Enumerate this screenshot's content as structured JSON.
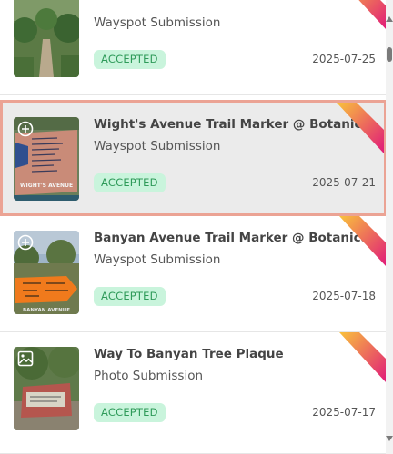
{
  "colors": {
    "selected_border": "#eba394",
    "badge_bg": "#c9f4dc",
    "badge_text": "#2e9a59",
    "corner_gradient": [
      "#f9c23c",
      "#e0187a"
    ]
  },
  "submissions": [
    {
      "title": "",
      "type": "Wayspot Submission",
      "status": "ACCEPTED",
      "date": "2025-07-25",
      "icon": "none"
    },
    {
      "title": "Wight's Avenue Trail Marker @ Botanical Garden",
      "type": "Wayspot Submission",
      "status": "ACCEPTED",
      "date": "2025-07-21",
      "icon": "plus-circle-icon",
      "selected": true,
      "thumb_caption": "WIGHT'S AVENUE"
    },
    {
      "title": "Banyan Avenue Trail Marker @ Botanical Garden",
      "type": "Wayspot Submission",
      "status": "ACCEPTED",
      "date": "2025-07-18",
      "icon": "plus-circle-icon",
      "thumb_caption": "BANYAN AVENUE"
    },
    {
      "title": "Way To Banyan Tree Plaque",
      "type": "Photo Submission",
      "status": "ACCEPTED",
      "date": "2025-07-17",
      "icon": "image-icon"
    }
  ]
}
